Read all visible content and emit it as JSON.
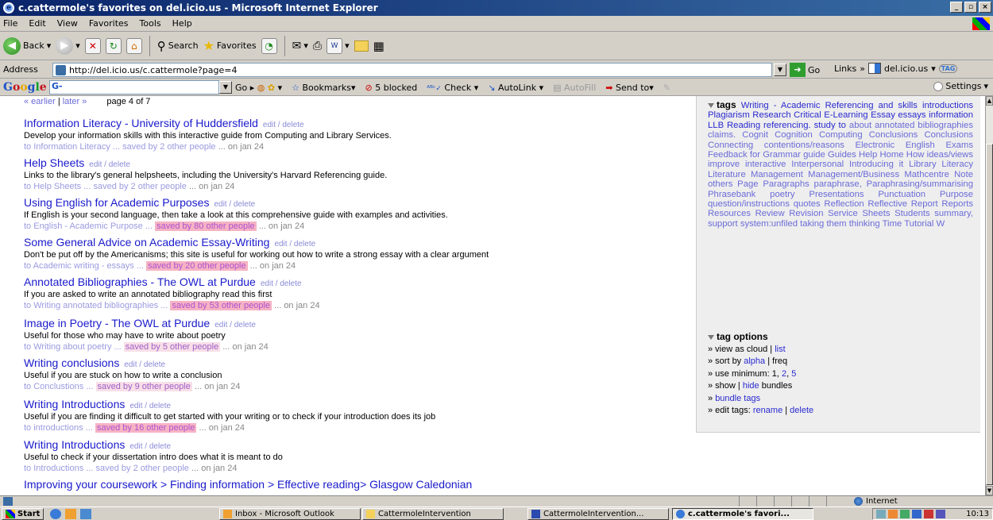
{
  "window": {
    "title": "c.cattermole's favorites on del.icio.us - Microsoft Internet Explorer"
  },
  "menu": [
    "File",
    "Edit",
    "View",
    "Favorites",
    "Tools",
    "Help"
  ],
  "toolbar": {
    "back": "Back",
    "search": "Search",
    "favorites": "Favorites"
  },
  "address": {
    "label": "Address",
    "url": "http://del.icio.us/c.cattermole?page=4",
    "go": "Go",
    "links": "Links",
    "links_chevron": "»",
    "delicious": "del.icio.us",
    "tag": "TAG"
  },
  "google": {
    "logo": "Google",
    "field": "G-",
    "go": "Go",
    "bookmarks": "Bookmarks",
    "blocked": "5 blocked",
    "check": "Check",
    "autolink": "AutoLink",
    "autofill": "AutoFill",
    "sendto": "Send to",
    "settings": "Settings"
  },
  "pager": {
    "earlier": "« earlier",
    "sep": "|",
    "later": "later »",
    "page": "page 4 of 7"
  },
  "posts": [
    {
      "title": "Information Literacy - University of Huddersfield",
      "edit": "edit",
      "del": "delete",
      "desc": "Develop your information skills with this interactive guide from Computing and Library Services.",
      "tags": "to Information Literacy ...",
      "saved": "saved by 2 other people",
      "hot": "cool",
      "date": "... on jan 24"
    },
    {
      "title": "Help Sheets",
      "edit": "edit",
      "del": "delete",
      "desc": "Links to the library's general helpsheets, including the University's Harvard Referencing guide.",
      "tags": "to Help Sheets ...",
      "saved": "saved by 2 other people",
      "hot": "cool",
      "date": "... on jan 24"
    },
    {
      "title": "Using English for Academic Purposes",
      "edit": "edit",
      "del": "delete",
      "desc": "If English is your second language, then take a look at this comprehensive guide with examples and activities.",
      "tags": "to English - Academic Purpose ...",
      "saved": "saved by 80 other people",
      "hot": "hot",
      "date": "... on jan 24"
    },
    {
      "title": "Some General Advice on Academic Essay-Writing",
      "edit": "edit",
      "del": "delete",
      "desc": "Don't be put off by the Americanisms; this site is useful for working out how to write a strong essay with a clear argument",
      "tags": "to Academic writing - essays ...",
      "saved": "saved by 20 other people",
      "hot": "hot",
      "date": "... on jan 24"
    },
    {
      "title": "Annotated Bibliographies - The OWL at Purdue",
      "edit": "edit",
      "del": "delete",
      "desc": "If you are asked to write an annotated bibliography read this first",
      "tags": "to Writing annotated bibliographies ...",
      "saved": "saved by 53 other people",
      "hot": "hot",
      "date": "... on jan 24"
    },
    {
      "title": "Image in Poetry - The OWL at Purdue",
      "edit": "edit",
      "del": "delete",
      "desc": "Useful for those who may have to write about poetry",
      "tags": "to Writing about poetry ...",
      "saved": "saved by 5 other people",
      "hot": "warm",
      "date": "... on jan 24"
    },
    {
      "title": "Writing conclusions",
      "edit": "edit",
      "del": "delete",
      "desc": "Useful if you are stuck on how to write a conclusion",
      "tags": "to Conclustions ...",
      "saved": "saved by 9 other people",
      "hot": "warm",
      "date": "... on jan 24"
    },
    {
      "title": "Writing Introductions",
      "edit": "edit",
      "del": "delete",
      "desc": "Useful if you are finding it difficult to get started with your writing or to check if your introduction does its job",
      "tags": "to introductions ...",
      "saved": "saved by 16 other people",
      "hot": "hot",
      "date": "... on jan 24"
    },
    {
      "title": "Writing Introductions",
      "edit": "edit",
      "del": "delete",
      "desc": "Useful to check if your dissertation intro does what it is meant to do",
      "tags": "to Introductions ...",
      "saved": "saved by 2 other people",
      "hot": "cool",
      "date": "... on jan 24"
    },
    {
      "title": "Improving your coursework > Finding information > Effective reading> Glasgow Caledonian",
      "edit": "",
      "del": "",
      "desc": "",
      "tags": "",
      "saved": "",
      "hot": "",
      "date": ""
    }
  ],
  "sidebar": {
    "tags_heading": "tags",
    "tags_big": "Writing - Academic Referencing and skills introductions Plagiarism Research Critical E-Learning Essay essays information LLB Reading referencing. study to",
    "tags_small": "about annotated bibliographies claims. Cognit Cognition Computing Conclusions Conclusions Connecting contentions/reasons Electronic English Exams Feedback for Grammar guide Guides Help Home How ideas/views improve interactive Interpersonal Introducing it Library Literacy Literature Management Management/Business Mathcentre Note others Page Paragraphs paraphrase, Paraphrasing/summarising Phrasebank poetry Presentations Punctuation Purpose question/instructions quotes Reflection Reflective Report Reports Resources Review Revision Service Sheets Students summary, support system:unfiled taking them thinking Time Tutorial W",
    "options_heading": "tag options",
    "opt_view": "» view as cloud |",
    "opt_list": "list",
    "opt_sort": "» sort by",
    "opt_alpha": "alpha",
    "opt_freq": "| freq",
    "opt_min": "» use minimum: 1,",
    "opt_min2": "2",
    "opt_min_comma": ",",
    "opt_min5": "5",
    "opt_show": "» show |",
    "opt_hide": "hide",
    "opt_bundles": "bundles",
    "opt_bundle_prefix": "»",
    "opt_bundle": "bundle tags",
    "opt_edit": "» edit tags:",
    "opt_rename": "rename",
    "opt_sep": "|",
    "opt_delete": "delete"
  },
  "status": {
    "zone": "Internet"
  },
  "taskbar": {
    "start": "Start",
    "tasks": [
      "Inbox - Microsoft Outlook",
      "CattermoleIntervention",
      "CattermoleIntervention...",
      "c.cattermole's favori..."
    ],
    "clock": "10:13"
  }
}
